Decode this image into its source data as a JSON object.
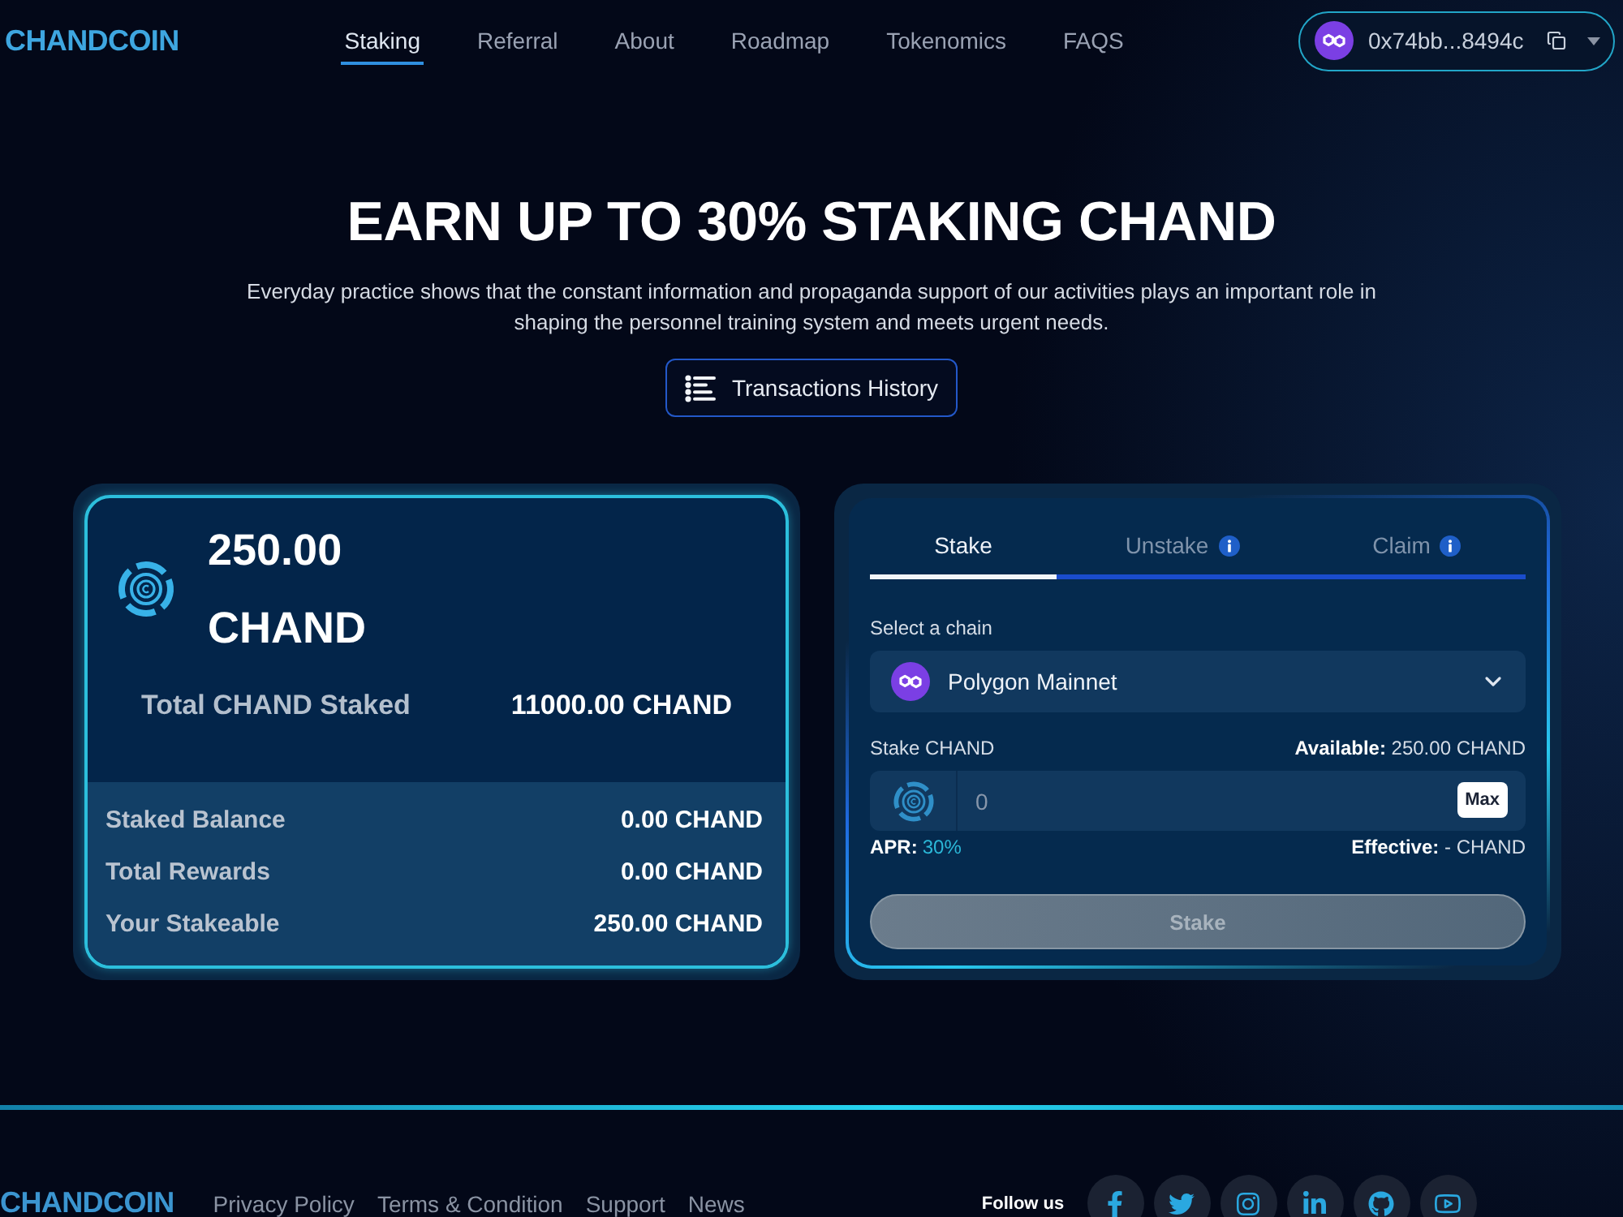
{
  "header": {
    "logo": "CHANDCOIN",
    "nav": [
      {
        "label": "Staking",
        "selected": true
      },
      {
        "label": "Referral",
        "selected": false
      },
      {
        "label": "About",
        "selected": false
      },
      {
        "label": "Roadmap",
        "selected": false
      },
      {
        "label": "Tokenomics",
        "selected": false
      },
      {
        "label": "FAQS",
        "selected": false
      }
    ],
    "wallet": {
      "address": "0x74bb...8494c"
    }
  },
  "hero": {
    "title": "EARN UP TO 30% STAKING CHAND",
    "description": "Everyday practice shows that the constant information and propaganda support of our activities plays an important role in shaping the personnel training system and meets urgent needs.",
    "history_button": "Transactions History"
  },
  "summary": {
    "balance": "250.00 CHAND",
    "total_label": "Total CHAND Staked",
    "total_value": "11000.00 CHAND",
    "rows": [
      {
        "label": "Staked Balance",
        "value": "0.00 CHAND"
      },
      {
        "label": "Total Rewards",
        "value": "0.00 CHAND"
      },
      {
        "label": "Your Stakeable",
        "value": "250.00 CHAND"
      }
    ]
  },
  "stake_panel": {
    "tabs": [
      {
        "label": "Stake",
        "selected": true,
        "info": false
      },
      {
        "label": "Unstake",
        "selected": false,
        "info": true
      },
      {
        "label": "Claim",
        "selected": false,
        "info": true
      }
    ],
    "chain_label": "Select a chain",
    "chain": "Polygon Mainnet",
    "amount_label": "Stake CHAND",
    "available": "**Available:** 250.00 CHAND",
    "amount_placeholder": "0",
    "max_button": "Max",
    "apr_label": "APR:",
    "apr_value": "30%",
    "effective": "**Effective:** - CHAND",
    "submit": {
      "label": "Stake",
      "disabled": true
    }
  },
  "footer": {
    "logo": "CHANDCOIN",
    "links": [
      "Privacy Policy",
      "Terms & Condition",
      "Support",
      "News"
    ],
    "follow_label": "Follow us",
    "socials": [
      {
        "kind": "facebook"
      },
      {
        "kind": "twitter"
      },
      {
        "kind": "instagram"
      },
      {
        "kind": "linkedin"
      },
      {
        "kind": "github"
      },
      {
        "kind": "youtube"
      }
    ]
  }
}
